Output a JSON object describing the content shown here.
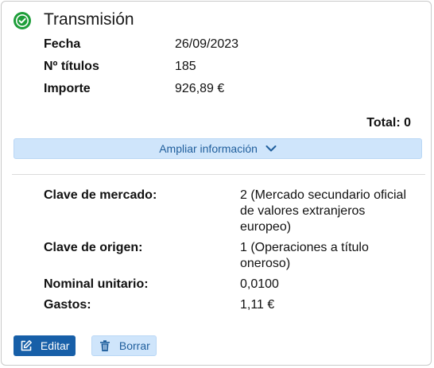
{
  "card": {
    "title": "Transmisión",
    "status_icon": "check-circle-icon",
    "status_color": "#1e9e3a"
  },
  "summary": [
    {
      "label": "Fecha",
      "value": "26/09/2023"
    },
    {
      "label": "Nº títulos",
      "value": "185"
    },
    {
      "label": "Importe",
      "value": "926,89 €"
    }
  ],
  "total": "Total: 0",
  "expand": {
    "label": "Ampliar información",
    "icon": "chevron-down-icon"
  },
  "details": [
    {
      "label": "Clave de mercado:",
      "value": "2 (Mercado secundario oficial de valores extranjeros europeo)"
    },
    {
      "label": "Clave de origen:",
      "value": "1 (Operaciones a título oneroso)"
    },
    {
      "label": "Nominal unitario:",
      "value": "0,0100"
    },
    {
      "label": "Gastos:",
      "value": "1,11 €"
    }
  ],
  "actions": {
    "edit_label": "Editar",
    "edit_icon": "edit-icon",
    "delete_label": "Borrar",
    "delete_icon": "trash-icon"
  },
  "colors": {
    "primary": "#175fa8",
    "light_blue": "#cfe5fb",
    "link_text": "#1f5e9c"
  }
}
